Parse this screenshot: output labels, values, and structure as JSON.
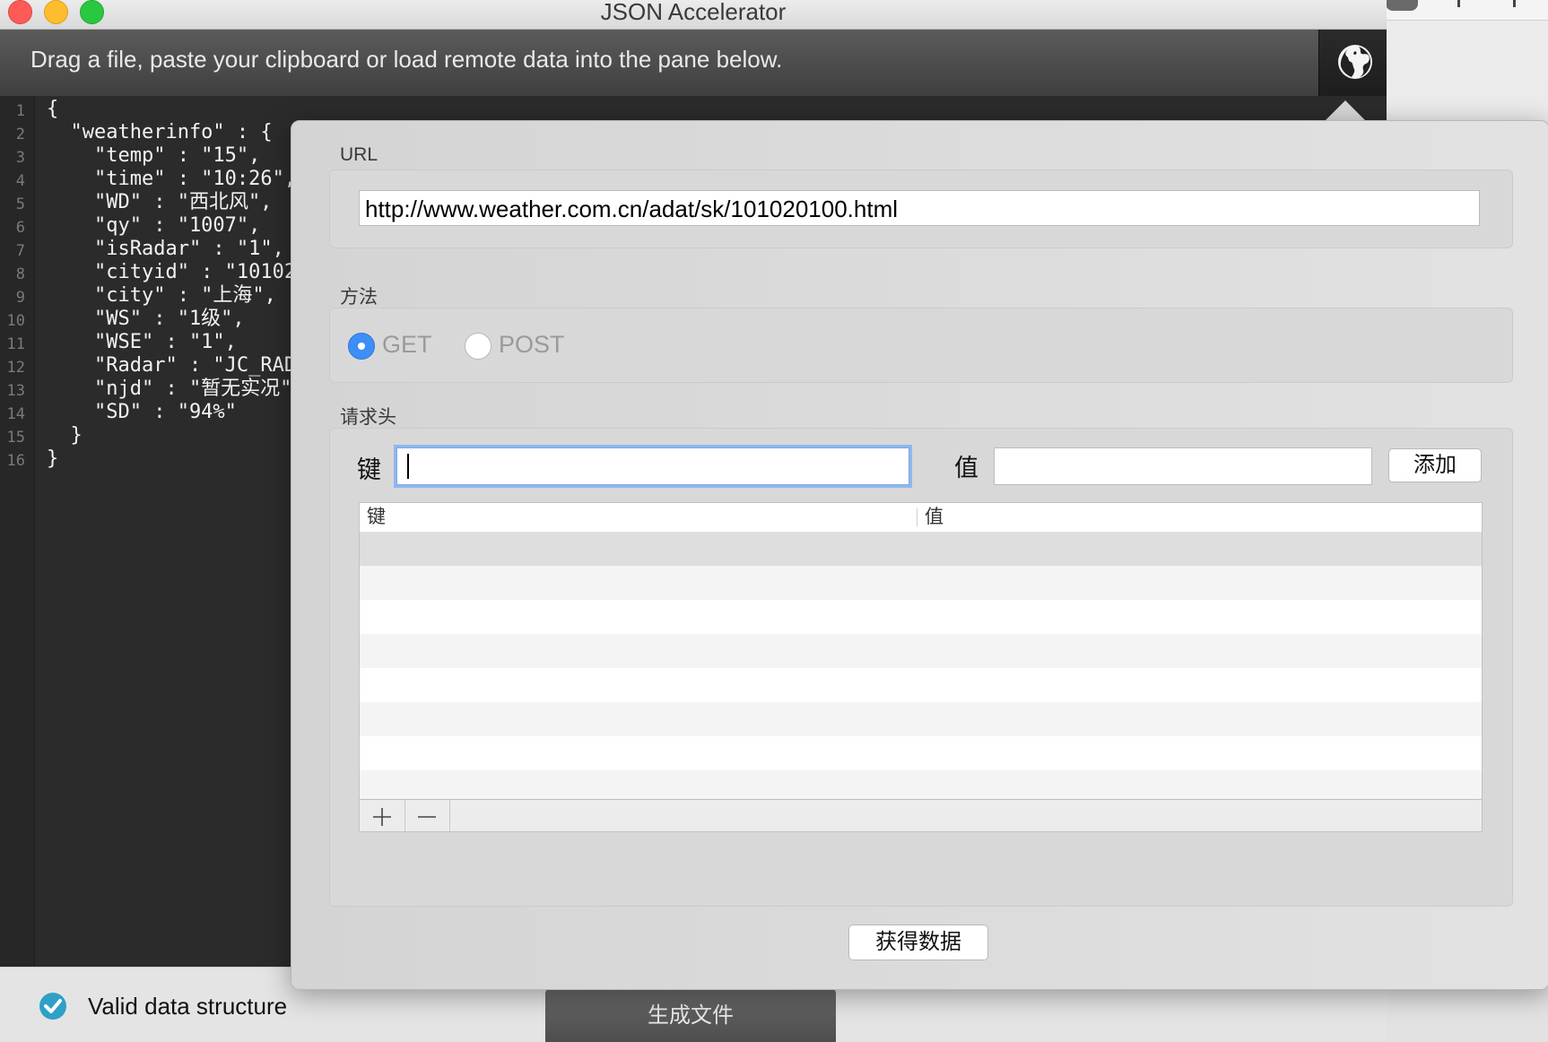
{
  "window": {
    "title": "JSON Accelerator",
    "toolbar_hint": "Drag a file, paste your clipboard or load remote data into the pane below.",
    "globe_button_icon": "globe-icon"
  },
  "editor": {
    "line_numbers": [
      "1",
      "2",
      "3",
      "4",
      "5",
      "6",
      "7",
      "8",
      "9",
      "10",
      "11",
      "12",
      "13",
      "14",
      "15",
      "16"
    ],
    "code": "{\n  \"weatherinfo\" : {\n    \"temp\" : \"15\",\n    \"time\" : \"10:26\",\n    \"WD\" : \"西北风\",\n    \"qy\" : \"1007\",\n    \"isRadar\" : \"1\",\n    \"cityid\" : \"10102\n    \"city\" : \"上海\",\n    \"WS\" : \"1级\",\n    \"WSE\" : \"1\",\n    \"Radar\" : \"JC_RAD\n    \"njd\" : \"暂无实况\"\n    \"SD\" : \"94%\"\n  }\n}"
  },
  "status": {
    "valid_text": "Valid data structure",
    "generate_button": "生成文件",
    "check_color": "#2fa0c6"
  },
  "popover": {
    "url_label": "URL",
    "url_value": "http://www.weather.com.cn/adat/sk/101020100.html",
    "method_label": "方法",
    "method_options": [
      {
        "label": "GET",
        "selected": true
      },
      {
        "label": "POST",
        "selected": false
      }
    ],
    "headers_label": "请求头",
    "key_label": "键",
    "value_label": "值",
    "key_input_value": "",
    "value_input_value": "",
    "add_button": "添加",
    "table_columns": [
      "键",
      "值"
    ],
    "table_rows": [],
    "add_row_icon": "plus-icon",
    "remove_row_icon": "minus-icon",
    "fetch_button": "获得数据",
    "accent_color": "#3d8ef6"
  }
}
